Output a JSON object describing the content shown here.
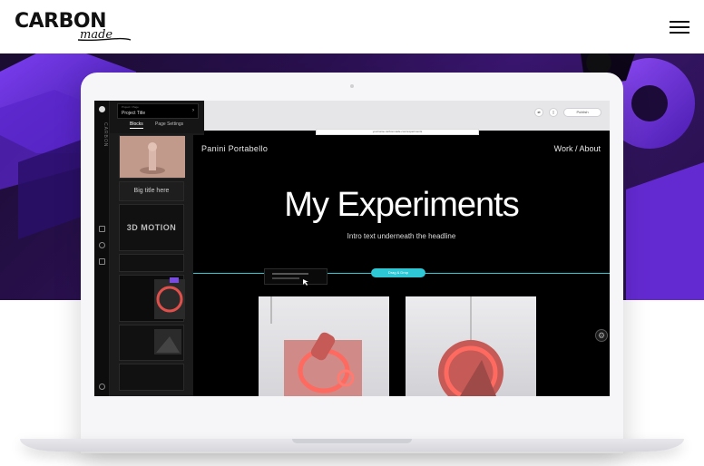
{
  "brand": {
    "logo_text": "CARBON",
    "logo_script": "made"
  },
  "header": {
    "menu_icon": "hamburger-icon"
  },
  "editor": {
    "project_caption": "Project / Page",
    "project_title": "Project Title",
    "tabs": [
      "Blocks",
      "Page Settings"
    ],
    "thumbs": [
      {
        "label": ""
      },
      {
        "label": "Big title here"
      },
      {
        "label": "3D MOTION"
      },
      {
        "label": ""
      },
      {
        "label": ""
      },
      {
        "label": ""
      },
      {
        "label": ""
      }
    ],
    "url_text": "yourname.carbonmade.com/experiments",
    "toolbar_publish": "Publish",
    "rail_brand": "CARBON"
  },
  "site": {
    "name": "Panini Portabello",
    "nav": "Work / About",
    "headline": "My Experiments",
    "intro": "Intro text underneath the headline",
    "cta": "Drag & Drop"
  },
  "colors": {
    "accent": "#2ec7d6",
    "hero": "#3a1670"
  }
}
